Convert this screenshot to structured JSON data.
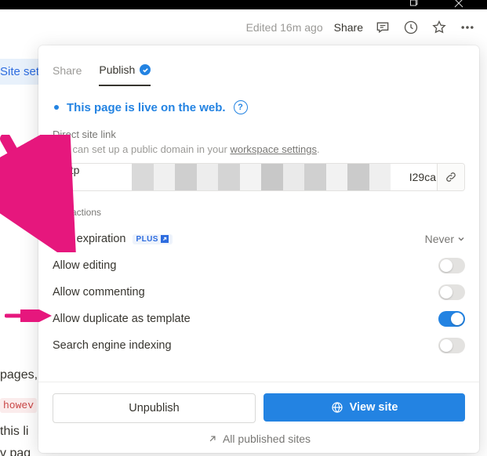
{
  "titlebar": {},
  "topbar": {
    "edited": "Edited 16m ago",
    "share": "Share"
  },
  "background": {
    "site_settings": "Site set",
    "pages": "pages,",
    "code": "howev",
    "this_link": "this li",
    "v_pag": "v pag"
  },
  "panel": {
    "tabs": {
      "share": "Share",
      "publish": "Publish"
    },
    "live_text": "This page is live on the web.",
    "direct_link_label": "Direct site link",
    "help_text_prefix": "You can set up a public domain in your ",
    "help_text_link": "workspace settings",
    "help_text_suffix": ".",
    "url_prefix": "http",
    "url_tail": "I29ca",
    "site_actions_label": "Site actions",
    "actions": {
      "link_expiration": {
        "label": "Link expiration",
        "plus": "PLUS",
        "value": "Never"
      },
      "allow_editing": {
        "label": "Allow editing",
        "on": false
      },
      "allow_commenting": {
        "label": "Allow commenting",
        "on": false
      },
      "allow_duplicate": {
        "label": "Allow duplicate as template",
        "on": true
      },
      "seo": {
        "label": "Search engine indexing",
        "on": false
      }
    },
    "footer": {
      "unpublish": "Unpublish",
      "view_site": "View site",
      "all_sites": "All published sites"
    }
  }
}
